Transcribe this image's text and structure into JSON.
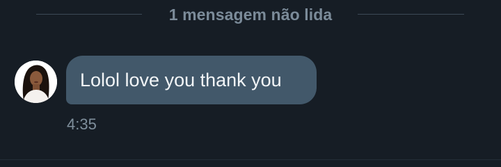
{
  "divider": {
    "label": "1 mensagem não lida"
  },
  "message": {
    "text": "Lolol love you thank you",
    "time": "4:35"
  },
  "colors": {
    "background": "#161d25",
    "bubble": "#42586a",
    "divider_text": "#7b8b99"
  }
}
